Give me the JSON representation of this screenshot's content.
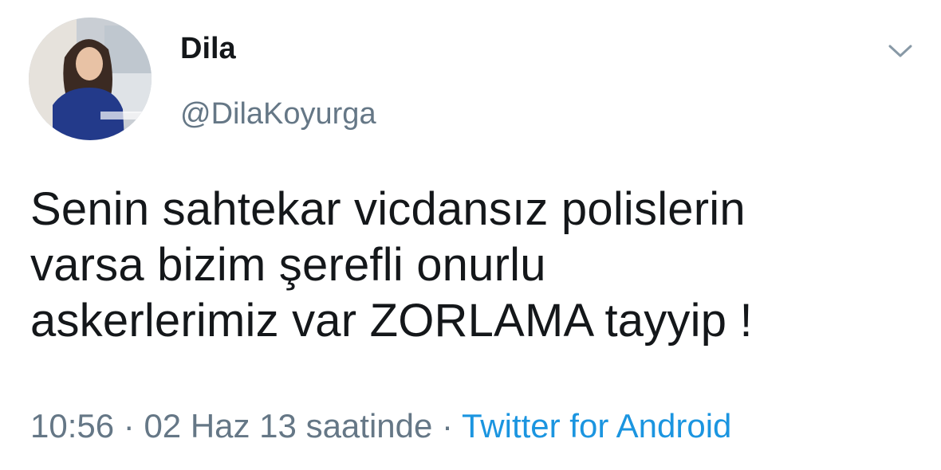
{
  "user": {
    "name": "Dila",
    "handle": "@DilaKoyurga"
  },
  "menu": {
    "icon": "chevron-down-icon"
  },
  "tweet": {
    "lines": [
      "Senin sahtekar vicdansız polislerin",
      "varsa bizim şerefli onurlu",
      "askerlerimiz var ZORLAMA tayyip !"
    ]
  },
  "meta": {
    "time": "10:56",
    "separator": " · ",
    "date": "02 Haz 13 saatinde",
    "source": "Twitter for Android"
  },
  "colors": {
    "text": "#14171a",
    "secondary": "#657786",
    "link": "#1b95e0",
    "background": "#ffffff"
  }
}
